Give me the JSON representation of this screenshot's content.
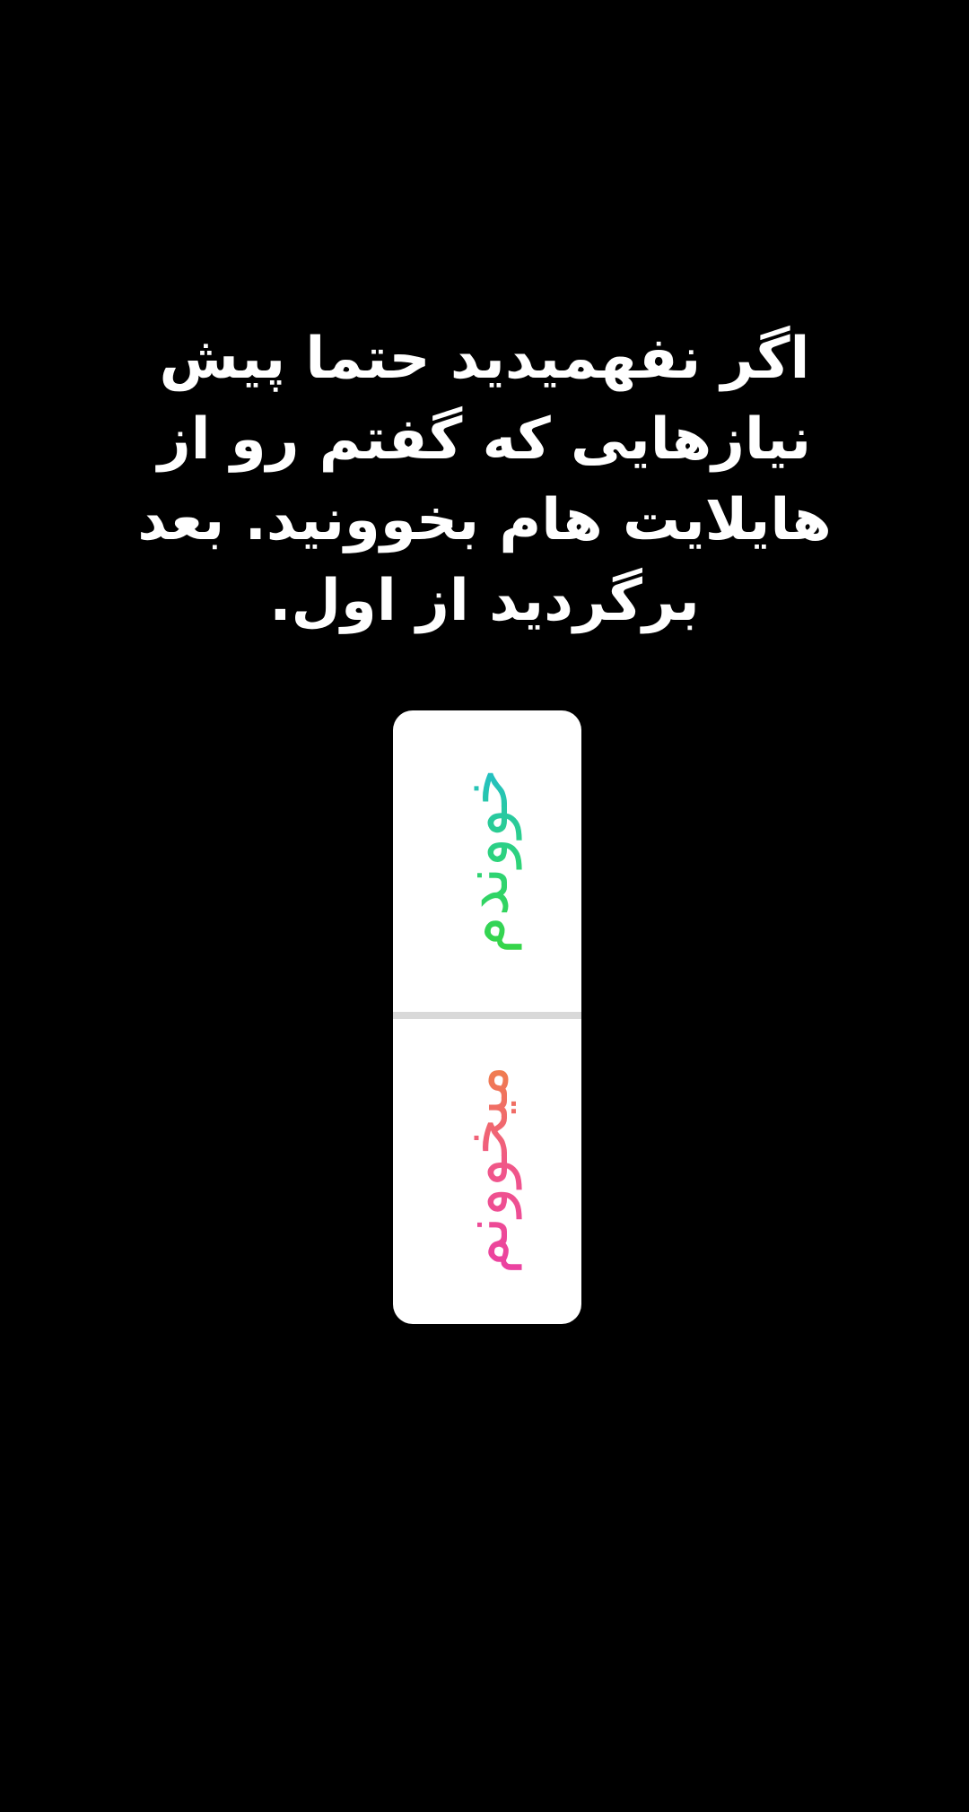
{
  "story": {
    "caption_lines": [
      "اگر نفهمیدید حتما پیش",
      "نیازهایی که گفتم رو از",
      "هایلایت هام بخوونید. بعد",
      "برگردید از اول."
    ]
  },
  "poll": {
    "options": [
      {
        "label": "خووندم",
        "gradient": [
          "#1fb6e8",
          "#3ad62e"
        ]
      },
      {
        "label": "میخوونم",
        "gradient": [
          "#f08a3a",
          "#e93aa8"
        ]
      }
    ],
    "card_color": "#ffffff",
    "divider_color": "#d9d9d9"
  },
  "colors": {
    "background": "#000000",
    "text": "#ffffff"
  }
}
